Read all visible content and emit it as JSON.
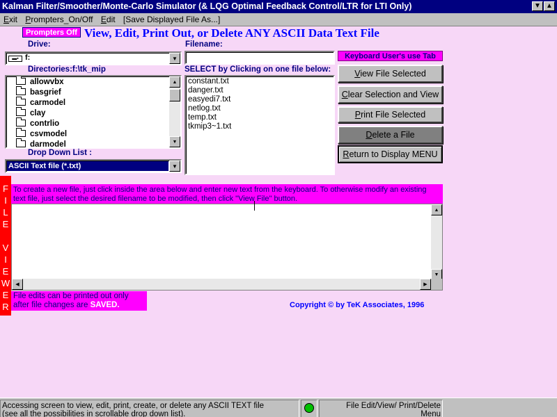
{
  "window": {
    "title": "Kalman Filter/Smoother/Monte-Carlo Simulator (& LQG Optimal Feedback Control/LTR for LTI Only)",
    "min_icon": "minimize-icon",
    "max_icon": "maximize-icon"
  },
  "menu": [
    {
      "mnemonic": "E",
      "rest": "xit"
    },
    {
      "mnemonic": "P",
      "rest": "rompters_On/Off"
    },
    {
      "mnemonic": "E",
      "rest": "dit"
    },
    {
      "mnemonic": "",
      "rest": "[Save Displayed File As...]"
    }
  ],
  "prompters_badge": "Prompters Off",
  "headline": "View, Edit, Print Out, or Delete ANY ASCII Data Text File",
  "drive": {
    "label": "Drive:",
    "value": "f:",
    "icon": "drive-icon"
  },
  "directories": {
    "label": "Directories:",
    "path": "f:\\tk_mip",
    "items": [
      "allowvbx",
      "basgrief",
      "carmodel",
      "clay",
      "contrlio",
      "csvmodel",
      "darmodel"
    ]
  },
  "dropdown": {
    "label": "Drop Down List :",
    "value": "ASCII Text file (*.txt)"
  },
  "filename": {
    "label": "Filename:",
    "value": ""
  },
  "select_label": "SELECT by Clicking on one file below:",
  "files": [
    "constant.txt",
    "danger.txt",
    "easyedi7.txt",
    "netlog.txt",
    "temp.txt",
    "tkmip3~1.txt"
  ],
  "keyboard_hint": "Keyboard User's use Tab",
  "buttons": {
    "view": {
      "pre": "",
      "mnemonic": "V",
      "rest": "iew File Selected"
    },
    "clear": {
      "pre": "",
      "mnemonic": "C",
      "rest": "lear Selection and View"
    },
    "print": {
      "pre": "",
      "mnemonic": "P",
      "rest": "rint File Selected"
    },
    "delete": {
      "pre": "",
      "mnemonic": "D",
      "rest": "elete a File"
    },
    "return": {
      "pre": "",
      "mnemonic": "R",
      "rest": "eturn to Display MENU"
    }
  },
  "file_viewer_side_label": [
    "F",
    "I",
    "L",
    "E",
    "",
    "V",
    "I",
    "E",
    "W",
    "E",
    "R"
  ],
  "instruction": "To create a new file, just click inside the area below and enter new text from the keyboard. To otherwise modify an existing text file, just select the desired filename to be modified, then click \"View File\" button.",
  "editor_text": "",
  "print_note": {
    "line1": "File edits can be printed out only",
    "line2_pre": "after  file changes are ",
    "line2_highlight": "SAVED."
  },
  "copyright": "Copyright © by TeK Associates, 1996",
  "status": {
    "message_line1": "Accessing screen to view, edit, print, create, or delete any ASCII TEXT file",
    "message_line2": "(see all the possibilities in scrollable drop down list).",
    "indicator_color": "#00c000",
    "right_line1": "File Edit/View/ Print/Delete",
    "right_line2": "Menu"
  },
  "colors": {
    "title_bg": "#000080",
    "magenta": "#ff00ff",
    "red": "#ff0000",
    "label_blue": "#000080"
  }
}
